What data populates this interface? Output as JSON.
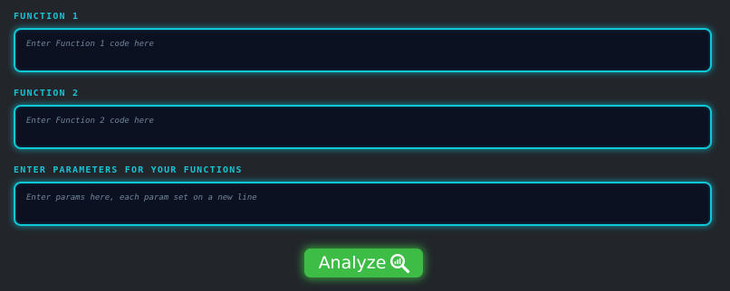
{
  "function1": {
    "label": "FUNCTION 1",
    "placeholder": "Enter Function 1 code here",
    "value": ""
  },
  "function2": {
    "label": "FUNCTION 2",
    "placeholder": "Enter Function 2 code here",
    "value": ""
  },
  "params": {
    "label": "ENTER PARAMETERS FOR YOUR FUNCTIONS",
    "placeholder": "Enter params here, each param set on a new line",
    "value": ""
  },
  "analyze_button": {
    "label": "Analyze",
    "icon": "magnifier-chart-icon"
  },
  "colors": {
    "background": "#22262b",
    "accent": "#10c7d6",
    "label": "#19c2d2",
    "input_bg": "#0c1122",
    "button": "#3dbd45"
  }
}
